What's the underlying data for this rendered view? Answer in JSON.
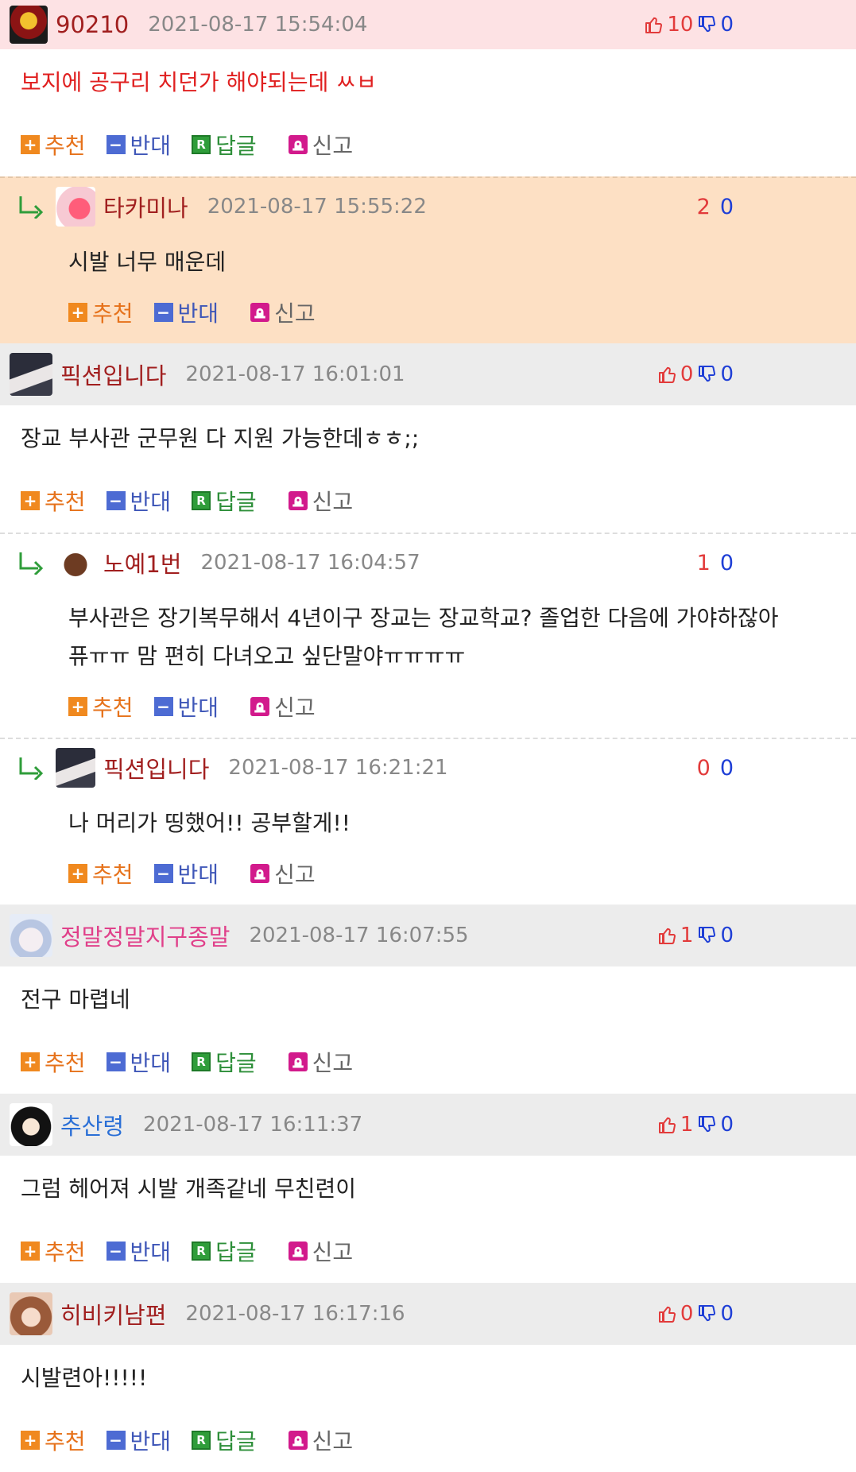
{
  "actions": {
    "recommend": "추천",
    "oppose": "반대",
    "reply": "답글",
    "report": "신고"
  },
  "colors": {
    "top_header_bg": "#ececec",
    "highlight_header_bg": "#fde2e4",
    "reply_highlight_bg": "#fde0c4",
    "vote_up": "#e23b3b",
    "vote_down": "#1f3fd6"
  },
  "comments": [
    {
      "type": "top",
      "highlight": true,
      "username": "90210",
      "username_color": "#a11f1f",
      "avatar_icon": "hell-logo-avatar",
      "timestamp": "2021-08-17 15:54:04",
      "up": "10",
      "down": "0",
      "text": "보지에 공구리 치던가 해야되는데 ㅆㅂ",
      "text_red": true
    },
    {
      "type": "reply",
      "highlight": true,
      "username": "타카미나",
      "username_color": "#a11f1f",
      "avatar_icon": "anime-girl-avatar",
      "timestamp": "2021-08-17 15:55:22",
      "up": "2",
      "down": "0",
      "text": "시발 너무 매운데",
      "text2": ""
    },
    {
      "type": "top",
      "highlight": false,
      "username": "픽션입니다",
      "username_color": "#a11f1f",
      "avatar_icon": "dark-hair-boy-avatar",
      "timestamp": "2021-08-17 16:01:01",
      "up": "0",
      "down": "0",
      "text": "장교 부사관 군무원 다 지원 가능한데ㅎㅎ;;",
      "text_red": false
    },
    {
      "type": "reply",
      "highlight": false,
      "username": "노예1번",
      "username_color": "#a11f1f",
      "avatar_icon": "slave-no1-avatar",
      "timestamp": "2021-08-17 16:04:57",
      "up": "1",
      "down": "0",
      "text": "부사관은 장기복무해서 4년이구 장교는 장교학교? 졸업한 다음에 가야하잖아",
      "text2": "퓨ㅠㅠ 맘 편히 다녀오고 싶단말야ㅠㅠㅠㅠ"
    },
    {
      "type": "reply",
      "highlight": false,
      "username": "픽션입니다",
      "username_color": "#a11f1f",
      "avatar_icon": "dark-hair-boy-avatar",
      "timestamp": "2021-08-17 16:21:21",
      "up": "0",
      "down": "0",
      "text": "나 머리가 띵했어!! 공부할게!!",
      "text2": ""
    },
    {
      "type": "top",
      "highlight": false,
      "username": "정말정말지구종말",
      "username_color": "#e0408a",
      "avatar_icon": "white-hair-girl-avatar",
      "timestamp": "2021-08-17 16:07:55",
      "up": "1",
      "down": "0",
      "text": "전구 마렵네",
      "text_red": false
    },
    {
      "type": "top",
      "highlight": false,
      "username": "추산령",
      "username_color": "#2a6fd6",
      "avatar_icon": "black-hair-girl-avatar",
      "timestamp": "2021-08-17 16:11:37",
      "up": "1",
      "down": "0",
      "text": "그럼 헤어져 시발 개족같네 무친련이",
      "text_red": false
    },
    {
      "type": "top",
      "highlight": false,
      "username": "히비키남편",
      "username_color": "#a11f1f",
      "avatar_icon": "brown-hair-girl-avatar",
      "timestamp": "2021-08-17 16:17:16",
      "up": "0",
      "down": "0",
      "text": "시발련아!!!!!",
      "text_red": false
    }
  ]
}
